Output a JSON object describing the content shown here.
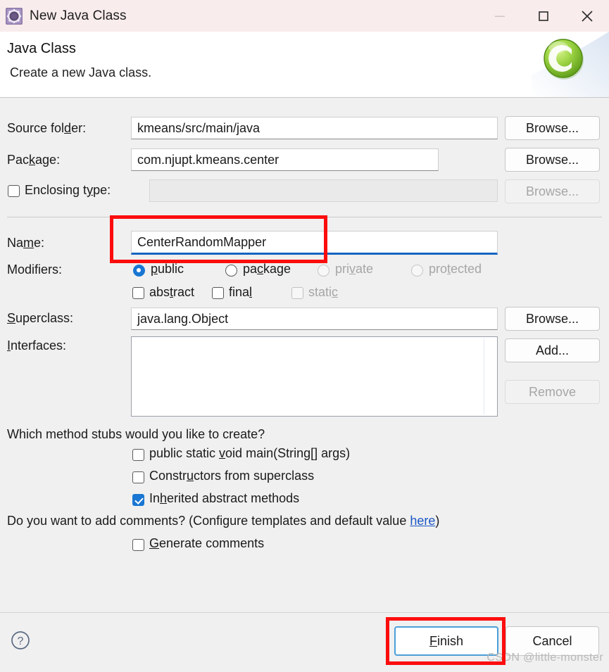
{
  "window": {
    "title": "New Java Class",
    "icon": "java-class-wizard-icon",
    "controls": {
      "minimize": "minimize-icon",
      "maximize": "maximize-icon",
      "close": "close-icon"
    }
  },
  "header": {
    "title": "Java Class",
    "subtitle": "Create a new Java class.",
    "banner_icon": "green-c-circle-icon"
  },
  "form": {
    "source_folder": {
      "label": "Source folder:",
      "label_pre": "Source fol",
      "label_mnemonic": "d",
      "label_post": "er:",
      "value": "kmeans/src/main/java",
      "browse": "Browse..."
    },
    "package": {
      "label": "Package:",
      "label_pre": "Pac",
      "label_mnemonic": "k",
      "label_post": "age:",
      "value": "com.njupt.kmeans.center",
      "browse": "Browse..."
    },
    "enclosing_type": {
      "label": "Enclosing type:",
      "label_pre": "Enclosing t",
      "label_mnemonic": "y",
      "label_post": "pe:",
      "value": "",
      "checked": false,
      "enabled": false,
      "browse": "Browse..."
    },
    "name": {
      "label": "Name:",
      "label_pre": "Na",
      "label_mnemonic": "m",
      "label_post": "e:",
      "value": "CenterRandomMapper",
      "focused": true
    },
    "modifiers": {
      "label": "Modifiers:",
      "radios": [
        {
          "label": "public",
          "pre": "",
          "mnemonic": "p",
          "post": "ublic",
          "selected": true,
          "enabled": true
        },
        {
          "label": "package",
          "pre": "pa",
          "mnemonic": "c",
          "post": "kage",
          "selected": false,
          "enabled": true
        },
        {
          "label": "private",
          "pre": "pri",
          "mnemonic": "v",
          "post": "ate",
          "selected": false,
          "enabled": false
        },
        {
          "label": "protected",
          "pre": "pro",
          "mnemonic": "t",
          "post": "ected",
          "selected": false,
          "enabled": false
        }
      ],
      "checkboxes": [
        {
          "label": "abstract",
          "pre": "abs",
          "mnemonic": "t",
          "post": "ract",
          "checked": false,
          "enabled": true
        },
        {
          "label": "final",
          "pre": "fina",
          "mnemonic": "l",
          "post": "",
          "checked": false,
          "enabled": true
        },
        {
          "label": "static",
          "pre": "stati",
          "mnemonic": "c",
          "post": "",
          "checked": false,
          "enabled": false
        }
      ]
    },
    "superclass": {
      "label": "Superclass:",
      "label_pre": "",
      "label_mnemonic": "S",
      "label_post": "uperclass:",
      "value": "java.lang.Object",
      "browse": "Browse..."
    },
    "interfaces": {
      "label": "Interfaces:",
      "label_pre": "",
      "label_mnemonic": "I",
      "label_post": "nterfaces:",
      "items": [],
      "add": "Add...",
      "remove": "Remove",
      "remove_enabled": false
    },
    "method_stubs": {
      "question": "Which method stubs would you like to create?",
      "options": [
        {
          "label": "public static void main(String[] args)",
          "pre": "public static ",
          "mnemonic": "v",
          "post": "oid main(String[] args)",
          "checked": false
        },
        {
          "label": "Constructors from superclass",
          "pre": "Constr",
          "mnemonic": "u",
          "post": "ctors from superclass",
          "checked": false
        },
        {
          "label": "Inherited abstract methods",
          "pre": "In",
          "mnemonic": "h",
          "post": "erited abstract methods",
          "checked": true
        }
      ]
    },
    "comments": {
      "question_pre": "Do you want to add comments? (Configure templates and default value ",
      "link": "here",
      "question_post": ")",
      "checkbox": {
        "label": "Generate comments",
        "pre": "",
        "mnemonic": "G",
        "post": "enerate comments",
        "checked": false
      }
    }
  },
  "footer": {
    "help_icon": "help-question-icon",
    "finish": {
      "label": "Finish",
      "pre": "",
      "mnemonic": "F",
      "post": "inish",
      "focused": true
    },
    "cancel": {
      "label": "Cancel"
    },
    "watermark": "CSDN @little-monster"
  },
  "annotations": {
    "name_highlight": "red-highlight-box-name-field",
    "finish_highlight": "red-highlight-box-finish-button"
  },
  "colors": {
    "titlebar": "#f9ecec",
    "accent": "#1976d2",
    "highlight": "#fc0d0d",
    "link": "#1a56c4",
    "body": "#f0f0f0"
  }
}
